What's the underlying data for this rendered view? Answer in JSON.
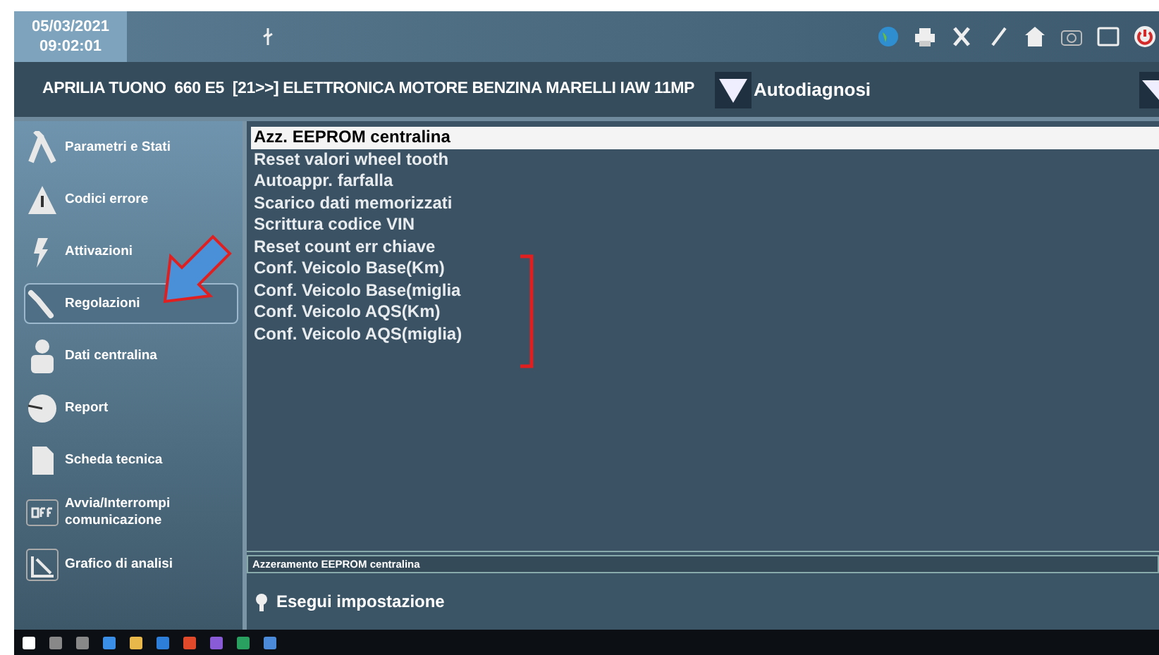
{
  "header": {
    "date": "05/03/2021",
    "time": "09:02:01"
  },
  "vehicle_bar": {
    "vehicle": "APRILIA TUONO  660 E5  [21>>] ELETTRONICA MOTORE BENZINA MARELLI IAW 11MP",
    "mode": "Autodiagnosi"
  },
  "sidebar": {
    "items": [
      {
        "label": "Parametri e Stati",
        "selected": false
      },
      {
        "label": "Codici errore",
        "selected": false
      },
      {
        "label": "Attivazioni",
        "selected": false
      },
      {
        "label": "Regolazioni",
        "selected": true
      },
      {
        "label": "Dati centralina",
        "selected": false
      },
      {
        "label": "Report",
        "selected": false
      },
      {
        "label": "Scheda tecnica",
        "selected": false
      },
      {
        "label": "Avvia/Interrompi comunicazione",
        "selected": false
      },
      {
        "label": "Grafico di analisi",
        "selected": false
      }
    ]
  },
  "list": {
    "items": [
      {
        "label": "Azz. EEPROM centralina",
        "selected": true
      },
      {
        "label": "Reset valori wheel tooth",
        "selected": false
      },
      {
        "label": "Autoappr. farfalla",
        "selected": false
      },
      {
        "label": "Scarico dati memorizzati",
        "selected": false
      },
      {
        "label": "Scrittura codice VIN",
        "selected": false
      },
      {
        "label": "Reset count err chiave",
        "selected": false
      },
      {
        "label": "Conf. Veicolo Base(Km)",
        "selected": false
      },
      {
        "label": "Conf. Veicolo Base(miglia",
        "selected": false
      },
      {
        "label": "Conf. Veicolo AQS(Km)",
        "selected": false
      },
      {
        "label": "Conf. Veicolo AQS(miglia)",
        "selected": false
      }
    ]
  },
  "status_line": "Azzeramento EEPROM centralina",
  "action_button": "Esegui impostazione"
}
